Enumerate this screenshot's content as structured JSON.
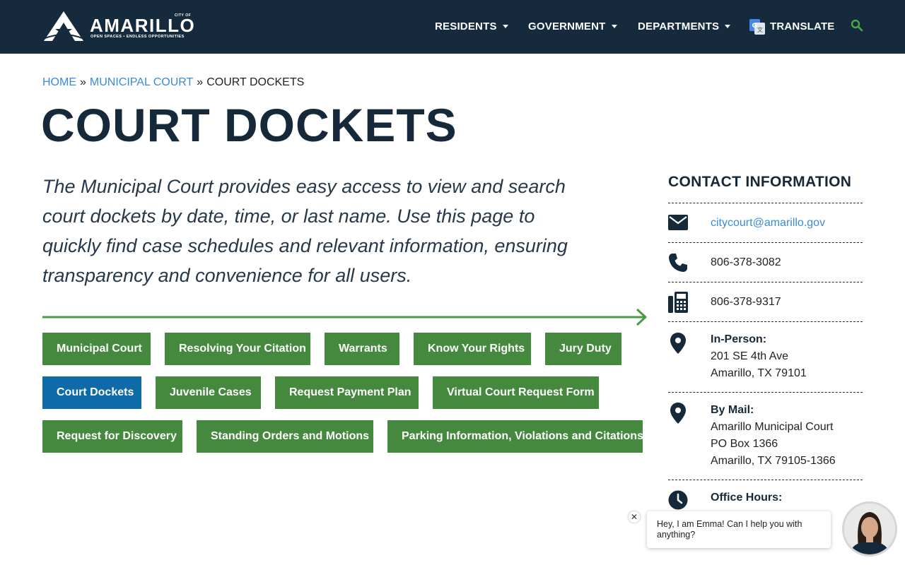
{
  "logo": {
    "city_of": "CITY OF",
    "word": "AMARILLO",
    "tagline": "OPEN SPACES • ENDLESS OPPORTUNITIES"
  },
  "nav": {
    "residents": "RESIDENTS",
    "government": "GOVERNMENT",
    "departments": "DEPARTMENTS",
    "translate": "TRANSLATE"
  },
  "breadcrumb": {
    "home": "HOME",
    "sep": "»",
    "municipal_court": "MUNICIPAL COURT",
    "current": "COURT DOCKETS"
  },
  "page": {
    "title": "COURT DOCKETS",
    "intro": "The Municipal Court provides easy access to view and search court dockets by date, time, or last name. Use this page to quickly find case schedules and relevant information, ensuring transparency and convenience for all users."
  },
  "buttons": [
    "Municipal Court",
    "Resolving Your Citation",
    "Warrants",
    "Know Your Rights",
    "Jury Duty",
    "Court Dockets",
    "Juvenile Cases",
    "Request Payment Plan",
    "Virtual Court Request Form",
    "Request for Discovery",
    "Standing Orders and Motions",
    "Parking Information, Violations and Citations"
  ],
  "contact": {
    "title": "CONTACT INFORMATION",
    "email": "citycourt@amarillo.gov",
    "phone": "806-378-3082",
    "fax": "806-378-9317",
    "in_person": {
      "label": "In-Person:",
      "line1": "201 SE 4th Ave",
      "line2": "Amarillo, TX 79101"
    },
    "by_mail": {
      "label": "By Mail:",
      "line1": "Amarillo Municipal Court",
      "line2": "PO Box 1366",
      "line3": "Amarillo, TX 79105-1366"
    },
    "office_hours": {
      "label": "Office Hours:"
    }
  },
  "chat": {
    "close": "✕",
    "message": "Hey, I am Emma! Can I help you with anything?"
  },
  "colors": {
    "header": "#152a3c",
    "button_green": "#45893f",
    "button_active": "#0f6aa8",
    "link": "#3a8ad8",
    "arrow": "#4a9a46"
  }
}
